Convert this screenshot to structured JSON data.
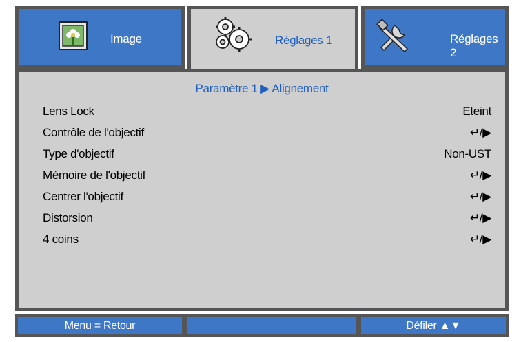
{
  "tabs": [
    {
      "label": "Image",
      "icon": "image-icon",
      "active": false
    },
    {
      "label": "Réglages 1",
      "icon": "gears-icon",
      "active": true
    },
    {
      "label": "Réglages 2",
      "icon": "tools-icon",
      "active": false
    }
  ],
  "breadcrumb": "Paramètre 1 ▶ Alignement",
  "menu_items": [
    {
      "label": "Lens Lock",
      "value": "Eteint"
    },
    {
      "label": "Contrôle de l'objectif",
      "value": "↵/▶"
    },
    {
      "label": "Type d'objectif",
      "value": "Non-UST"
    },
    {
      "label": "Mémoire de l'objectif",
      "value": "↵/▶"
    },
    {
      "label": "Centrer l'objectif",
      "value": "↵/▶"
    },
    {
      "label": "Distorsion",
      "value": "↵/▶"
    },
    {
      "label": "4 coins",
      "value": "↵/▶"
    }
  ],
  "footer": {
    "left": "Menu = Retour",
    "middle": "",
    "right": "Défiler ▲▼"
  },
  "colors": {
    "tab_blue": "#3f77c7",
    "panel_gray": "#cfcfcf",
    "border": "#555555",
    "accent_text": "#1f5fbf"
  }
}
